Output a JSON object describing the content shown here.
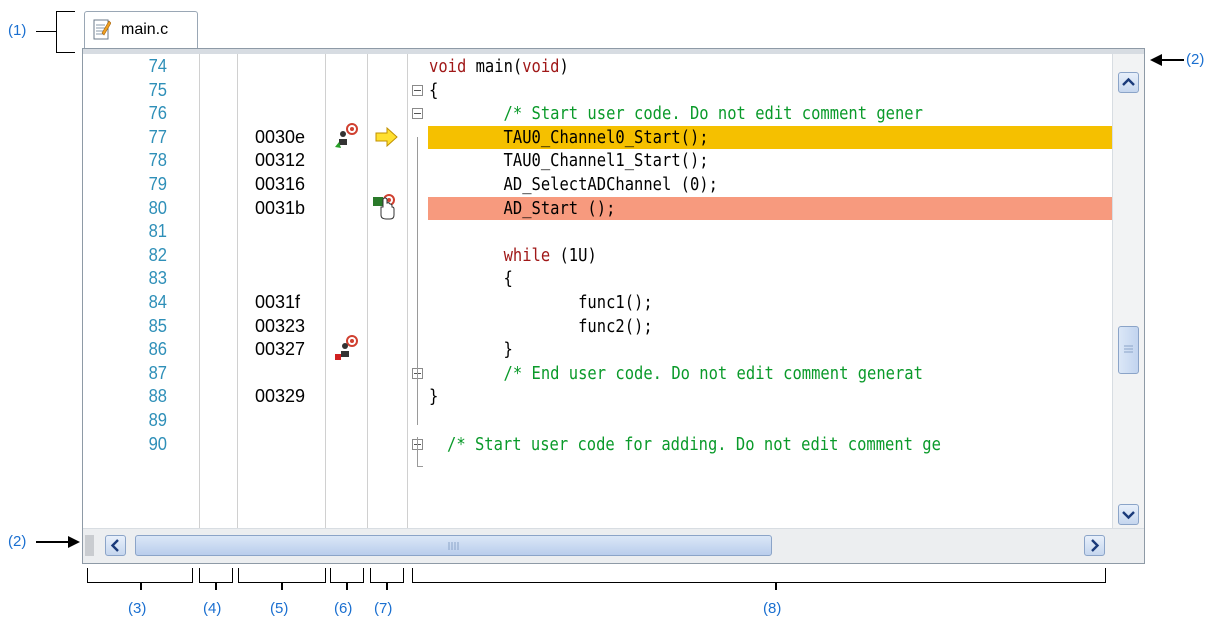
{
  "tab": {
    "filename": "main.c"
  },
  "callouts": {
    "c1": "(1)",
    "c2a": "(2)",
    "c2b": "(2)",
    "c3": "(3)",
    "c4": "(4)",
    "c5": "(5)",
    "c6": "(6)",
    "c7": "(7)",
    "c8": "(8)"
  },
  "lines": [
    {
      "num": "74",
      "addr": "",
      "code": "void main(void)"
    },
    {
      "num": "75",
      "addr": "",
      "code": "{"
    },
    {
      "num": "76",
      "addr": "",
      "code": "        /* Start user code. Do not edit comment gener"
    },
    {
      "num": "77",
      "addr": "0030e",
      "code": "        TAU0_Channel0_Start();"
    },
    {
      "num": "78",
      "addr": "00312",
      "code": "        TAU0_Channel1_Start();"
    },
    {
      "num": "79",
      "addr": "00316",
      "code": "        AD_SelectADChannel (0);"
    },
    {
      "num": "80",
      "addr": "0031b",
      "code": "        AD_Start ();"
    },
    {
      "num": "81",
      "addr": "",
      "code": ""
    },
    {
      "num": "82",
      "addr": "",
      "code": "        while (1U)"
    },
    {
      "num": "83",
      "addr": "",
      "code": "        {"
    },
    {
      "num": "84",
      "addr": "0031f",
      "code": "                func1();"
    },
    {
      "num": "85",
      "addr": "00323",
      "code": "                func2();"
    },
    {
      "num": "86",
      "addr": "00327",
      "code": "        }"
    },
    {
      "num": "87",
      "addr": "",
      "code": "        /* End user code. Do not edit comment generat"
    },
    {
      "num": "88",
      "addr": "00329",
      "code": "}"
    },
    {
      "num": "89",
      "addr": "",
      "code": ""
    },
    {
      "num": "90",
      "addr": "",
      "code": "/* Start user code for adding. Do not edit comment ge"
    }
  ],
  "colors": {
    "current_line": "#f5c000",
    "breakpoint_line": "#f79a7e",
    "line_number": "#2e8fb8",
    "keyword": "#a01818",
    "comment": "#0a9a2a",
    "callout": "#1a6fd0"
  }
}
